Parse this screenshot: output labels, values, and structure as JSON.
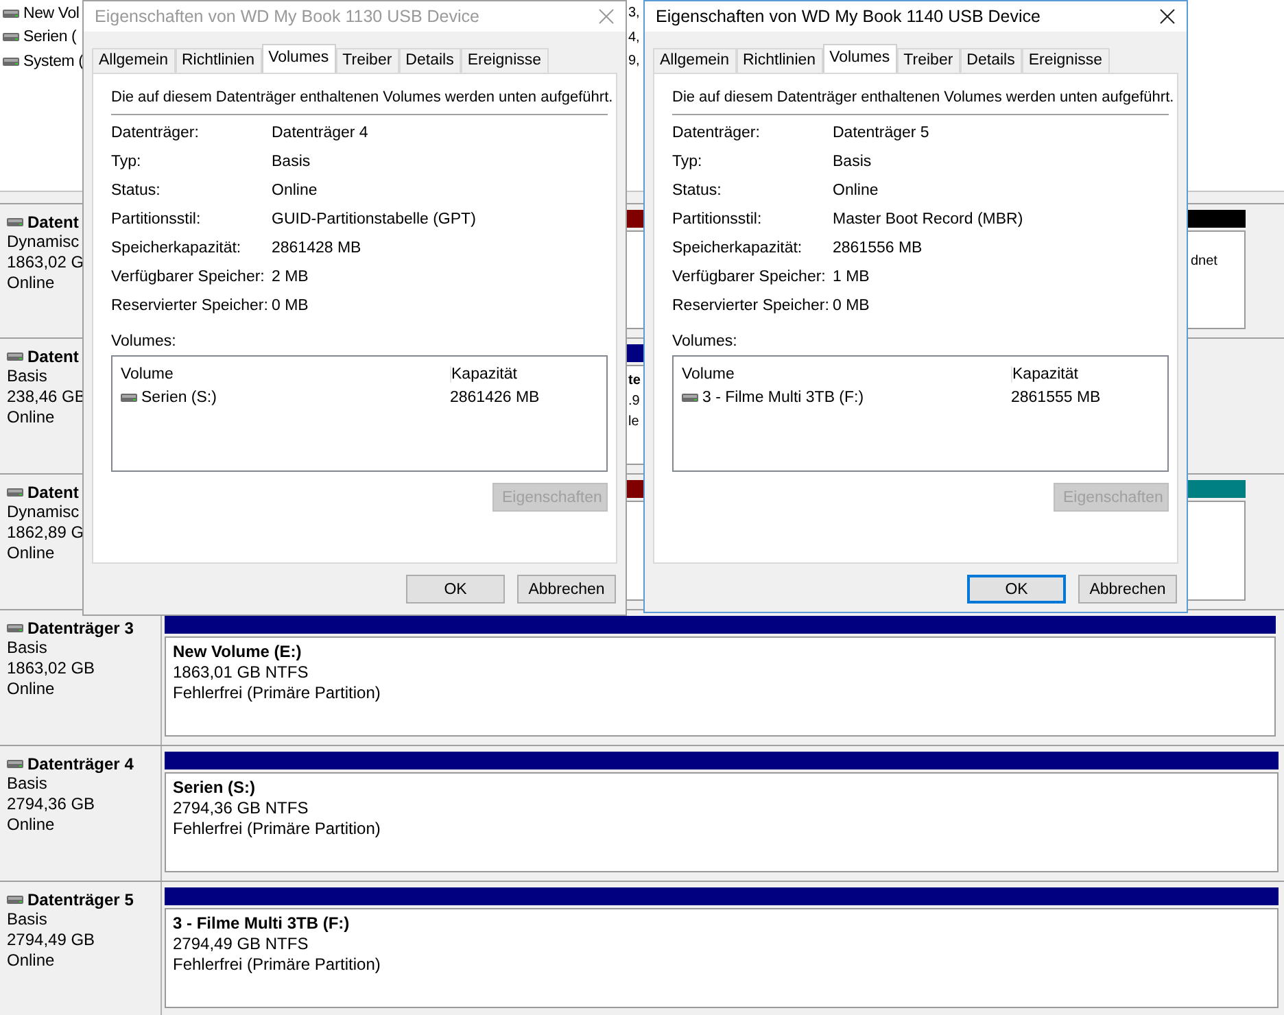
{
  "volume_list": [
    {
      "name": "New Vol",
      "column_2": "3,"
    },
    {
      "name": "Serien (",
      "column_2": "4,"
    },
    {
      "name": "System (",
      "column_2": "9,"
    }
  ],
  "disks": [
    {
      "name": "Datent",
      "type": "Dynamisc",
      "size": "1863,02 G",
      "status": "Online",
      "partitions": [
        {
          "color": "#800000"
        },
        {
          "color": "#000000",
          "lines": [
            "dnet"
          ]
        }
      ]
    },
    {
      "name": "Datent",
      "type": "Basis",
      "size": "238,46 GB",
      "status": "Online",
      "partitions": [
        {
          "color": "#000080",
          "title": "te",
          "lines": [
            ".9",
            "le"
          ]
        }
      ]
    },
    {
      "name": "Datent",
      "type": "Dynamisc",
      "size": "1862,89 G",
      "status": "Online",
      "partitions": [
        {
          "color": "#800000"
        },
        {
          "color": "#008080"
        }
      ]
    },
    {
      "name": "Datenträger 3",
      "type": "Basis",
      "size": "1863,02 GB",
      "status": "Online",
      "partitions": [
        {
          "color": "#000080",
          "title": "New Volume  (E:)",
          "lines": [
            "1863,01 GB NTFS",
            "Fehlerfrei (Primäre Partition)"
          ]
        }
      ]
    },
    {
      "name": "Datenträger 4",
      "type": "Basis",
      "size": "2794,36 GB",
      "status": "Online",
      "partitions": [
        {
          "color": "#000080",
          "title": "Serien  (S:)",
          "lines": [
            "2794,36 GB NTFS",
            "Fehlerfrei (Primäre Partition)"
          ]
        }
      ]
    },
    {
      "name": "Datenträger 5",
      "type": "Basis",
      "size": "2794,49 GB",
      "status": "Online",
      "partitions": [
        {
          "color": "#000080",
          "title": "3 - Filme Multi 3TB  (F:)",
          "lines": [
            "2794,49 GB NTFS",
            "Fehlerfrei (Primäre Partition)"
          ]
        }
      ]
    }
  ],
  "dialogs": [
    {
      "title": "Eigenschaften von WD My Book 1130 USB Device",
      "active": false,
      "tabs": [
        {
          "label": "Allgemein",
          "selected": false
        },
        {
          "label": "Richtlinien",
          "selected": false
        },
        {
          "label": "Volumes",
          "selected": true
        },
        {
          "label": "Treiber",
          "selected": false
        },
        {
          "label": "Details",
          "selected": false
        },
        {
          "label": "Ereignisse",
          "selected": false
        }
      ],
      "intro": "Die auf diesem Datenträger enthaltenen Volumes werden unten aufgeführt.",
      "properties": [
        {
          "label": "Datenträger:",
          "value": "Datenträger 4"
        },
        {
          "label": "Typ:",
          "value": "Basis"
        },
        {
          "label": "Status:",
          "value": "Online"
        },
        {
          "label": "Partitionsstil:",
          "value": "GUID-Partitionstabelle (GPT)"
        },
        {
          "label": "Speicherkapazität:",
          "value": "2861428 MB"
        },
        {
          "label": "Verfügbarer Speicher:",
          "value": "2 MB"
        },
        {
          "label": "Reservierter Speicher:",
          "value": "0 MB"
        }
      ],
      "volumes_label": "Volumes:",
      "columns": [
        "Volume",
        "Kapazität"
      ],
      "rows": [
        {
          "volume": "Serien (S:)",
          "capacity": "2861426 MB"
        }
      ],
      "properties_button": {
        "label": "Eigenschaften",
        "disabled": true
      },
      "buttons": [
        {
          "label": "OK",
          "default": false
        },
        {
          "label": "Abbrechen",
          "default": false
        }
      ]
    },
    {
      "title": "Eigenschaften von WD My Book 1140 USB Device",
      "active": true,
      "tabs": [
        {
          "label": "Allgemein",
          "selected": false
        },
        {
          "label": "Richtlinien",
          "selected": false
        },
        {
          "label": "Volumes",
          "selected": true
        },
        {
          "label": "Treiber",
          "selected": false
        },
        {
          "label": "Details",
          "selected": false
        },
        {
          "label": "Ereignisse",
          "selected": false
        }
      ],
      "intro": "Die auf diesem Datenträger enthaltenen Volumes werden unten aufgeführt.",
      "properties": [
        {
          "label": "Datenträger:",
          "value": "Datenträger 5"
        },
        {
          "label": "Typ:",
          "value": "Basis"
        },
        {
          "label": "Status:",
          "value": "Online"
        },
        {
          "label": "Partitionsstil:",
          "value": "Master Boot Record (MBR)"
        },
        {
          "label": "Speicherkapazität:",
          "value": "2861556 MB"
        },
        {
          "label": "Verfügbarer Speicher:",
          "value": "1 MB"
        },
        {
          "label": "Reservierter Speicher:",
          "value": "0 MB"
        }
      ],
      "volumes_label": "Volumes:",
      "columns": [
        "Volume",
        "Kapazität"
      ],
      "rows": [
        {
          "volume": "3 - Filme Multi 3TB (F:)",
          "capacity": "2861555 MB"
        }
      ],
      "properties_button": {
        "label": "Eigenschaften",
        "disabled": true
      },
      "buttons": [
        {
          "label": "OK",
          "default": true
        },
        {
          "label": "Abbrechen",
          "default": false
        }
      ]
    }
  ]
}
